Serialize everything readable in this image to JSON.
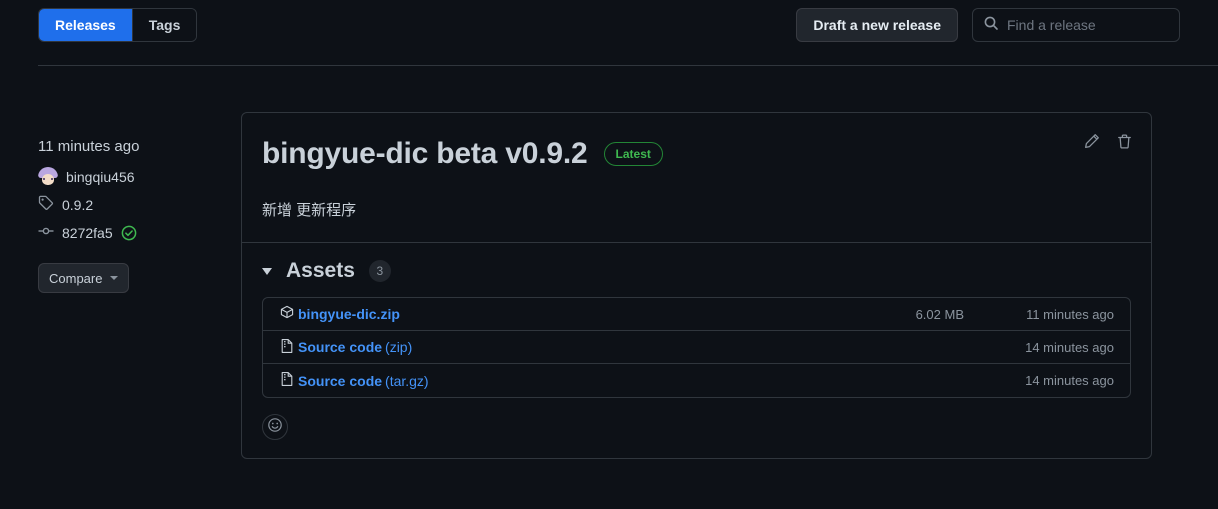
{
  "header": {
    "tabs": [
      {
        "label": "Releases",
        "active": true
      },
      {
        "label": "Tags",
        "active": false
      }
    ],
    "draft_button": "Draft a new release",
    "search_placeholder": "Find a release",
    "search_value": ""
  },
  "sidebar": {
    "published_ago": "11 minutes ago",
    "author": "bingqiu456",
    "tag": "0.9.2",
    "commit": "8272fa5",
    "compare_label": "Compare"
  },
  "release": {
    "title": "bingyue-dic beta v0.9.2",
    "badge": "Latest",
    "description": "新增 更新程序",
    "assets_title": "Assets",
    "assets_count": "3",
    "assets": [
      {
        "name": "bingyue-dic.zip",
        "suffix": "",
        "icon": "package-icon",
        "size": "6.02 MB",
        "time": "11 minutes ago"
      },
      {
        "name": "Source code",
        "suffix": " (zip)",
        "icon": "file-zip-icon",
        "size": "",
        "time": "14 minutes ago"
      },
      {
        "name": "Source code",
        "suffix": " (tar.gz)",
        "icon": "file-zip-icon",
        "size": "",
        "time": "14 minutes ago"
      }
    ]
  },
  "colors": {
    "background": "#0d1117",
    "border": "#30363d",
    "accent_blue": "#1f6feb",
    "link_blue": "#4493f8",
    "green": "#3fb950",
    "muted": "#8b949e"
  }
}
